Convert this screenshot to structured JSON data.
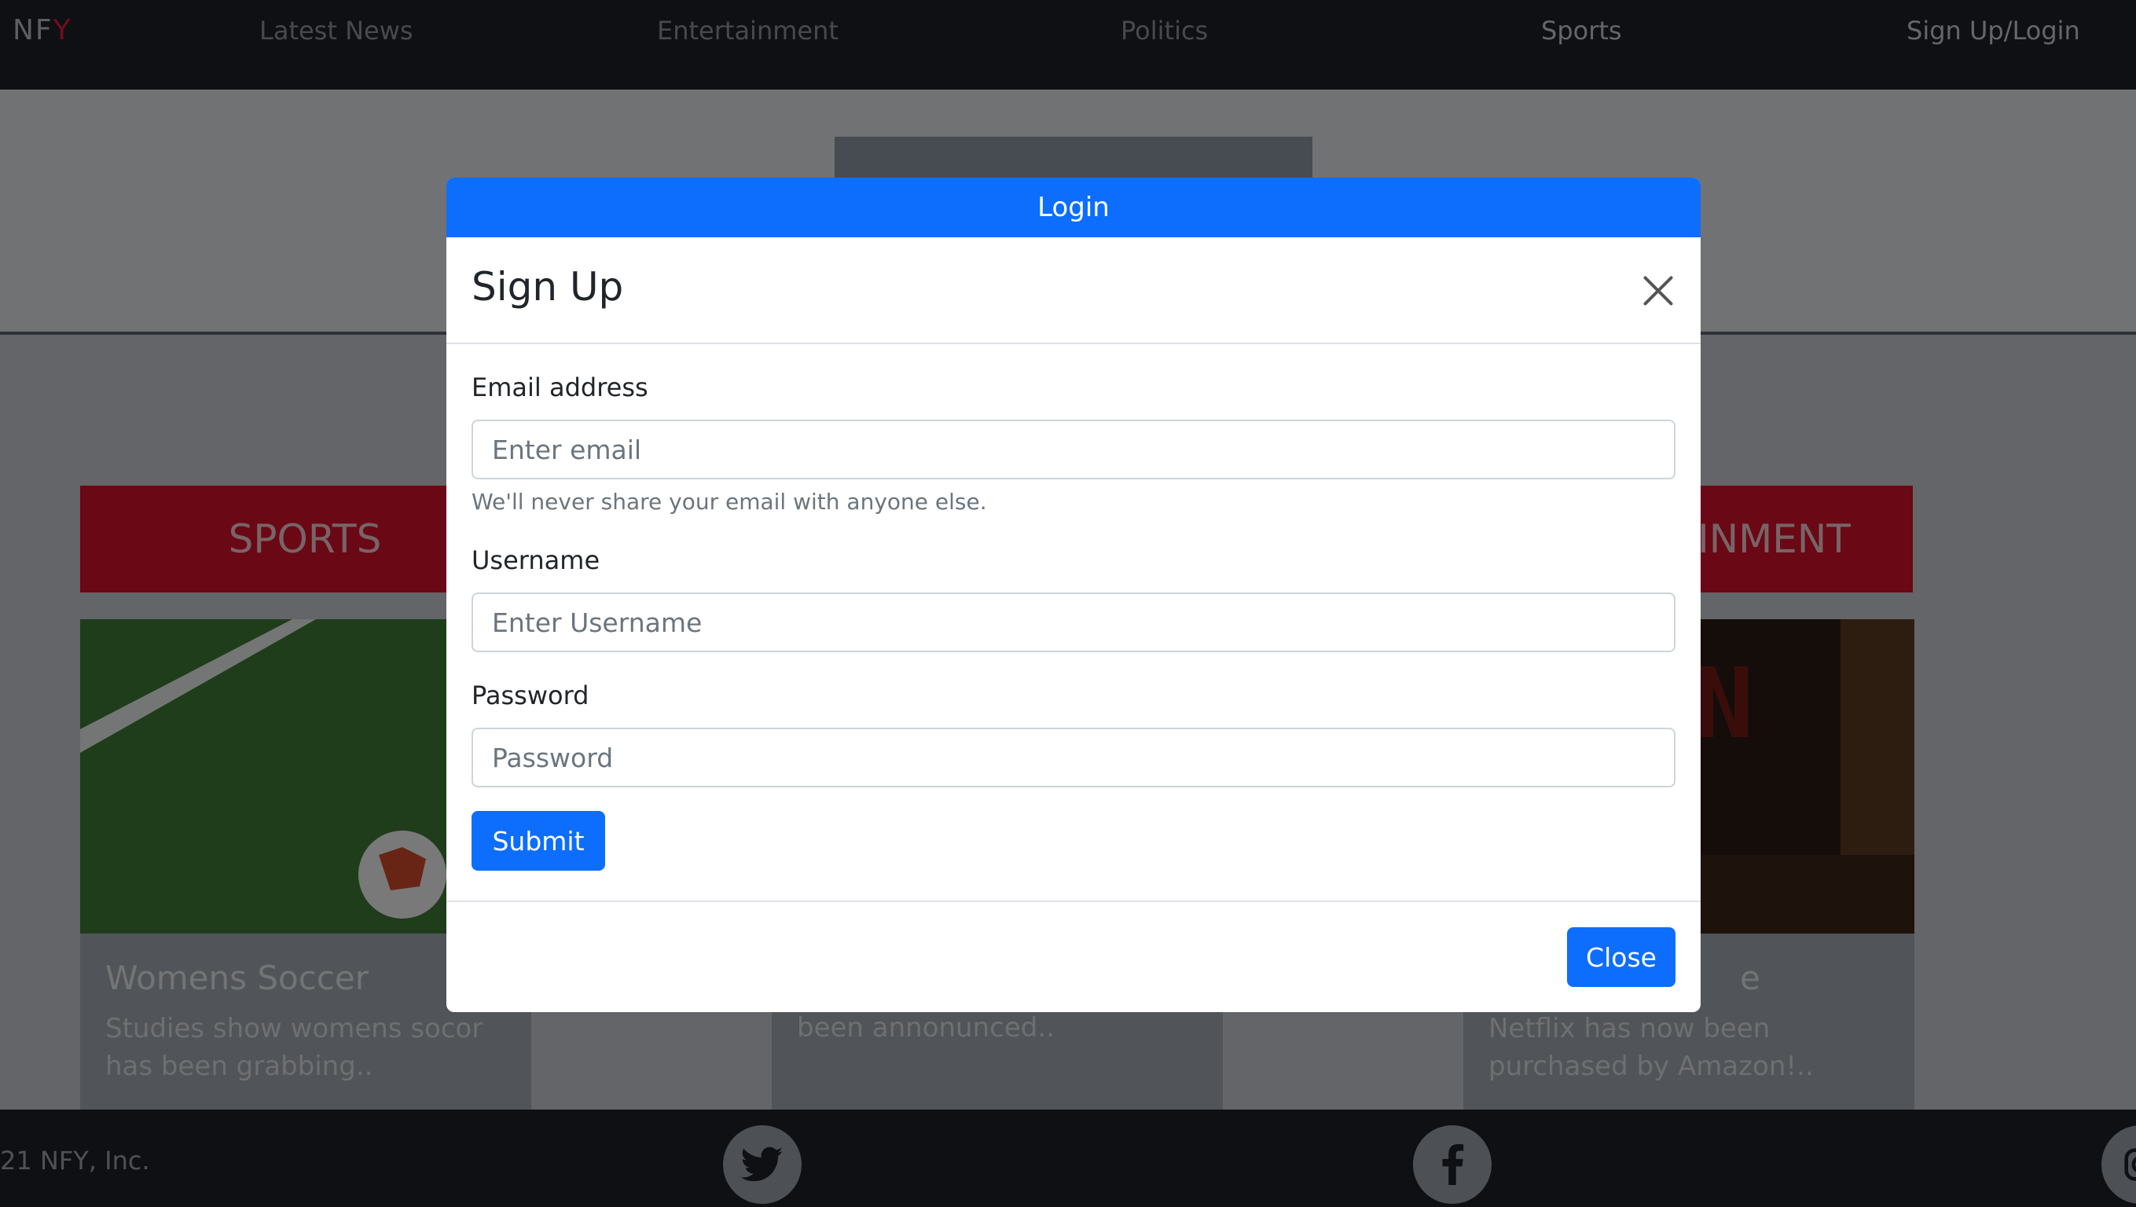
{
  "navbar": {
    "brand_prefix": "NF",
    "brand_suffix": "Y",
    "links": [
      "Latest News",
      "Entertainment",
      "Politics",
      "Sports",
      "Sign Up/Login"
    ]
  },
  "categories": {
    "sports": "SPORTS",
    "entertainment_partial": "INMENT"
  },
  "cards": [
    {
      "title": "Womens Soccer",
      "text": "Studies show womens socor has been grabbing.."
    },
    {
      "title": "",
      "text": "Most Mobbile Apps have now been annonunced.."
    },
    {
      "title": "e",
      "text": "Netflix has now been purchased by Amazon!.."
    }
  ],
  "footer": {
    "copyright": "21 NFY, Inc.",
    "icons": [
      "twitter-icon",
      "facebook-icon",
      "instagram-icon"
    ]
  },
  "modal": {
    "tab_label": "Login",
    "title": "Sign Up",
    "email_label": "Email address",
    "email_placeholder": "Enter email",
    "email_help": "We'll never share your email with anyone else.",
    "username_label": "Username",
    "username_placeholder": "Enter Username",
    "password_label": "Password",
    "password_placeholder": "Password",
    "submit_label": "Submit",
    "close_label": "Close"
  },
  "colors": {
    "primary": "#0d6efd",
    "category_red": "#d4102a",
    "navbar_dark": "#1e2128",
    "brand_accent": "#dc1e3c"
  }
}
